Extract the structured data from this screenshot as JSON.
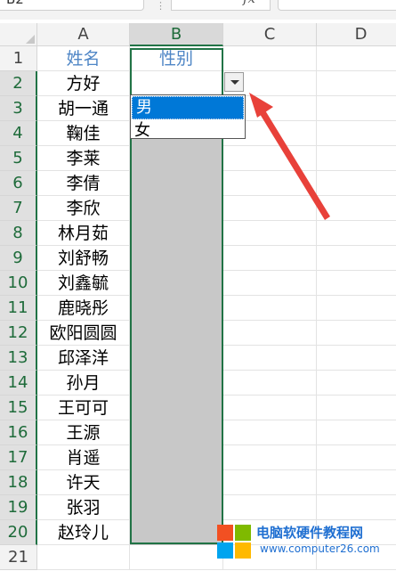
{
  "formula_bar": {
    "name_box": "B2",
    "fx_label": "fx",
    "formula": ""
  },
  "columns": [
    "A",
    "B",
    "C",
    "D"
  ],
  "rows": [
    "1",
    "2",
    "3",
    "4",
    "5",
    "6",
    "7",
    "8",
    "9",
    "10",
    "11",
    "12",
    "13",
    "14",
    "15",
    "16",
    "17",
    "18",
    "19",
    "20",
    "21"
  ],
  "sheet": {
    "headers": {
      "a": "姓名",
      "b": "性别"
    },
    "names": [
      "方好",
      "胡一通",
      "鞠佳",
      "李莱",
      "李倩",
      "李欣",
      "林月茹",
      "刘舒畅",
      "刘鑫毓",
      "鹿晓彤",
      "欧阳圆圆",
      "邱泽洋",
      "孙月",
      "王可可",
      "王源",
      "肖遥",
      "许天",
      "张羽",
      "赵玲儿"
    ]
  },
  "dropdown": {
    "options": [
      "男",
      "女"
    ],
    "highlighted_index": 0
  },
  "colors": {
    "selection_border": "#217346",
    "header_text": "#4f86c6",
    "dropdown_highlight": "#0078d7",
    "arrow": "#e8413a",
    "range_fill": "#c8c8c8"
  },
  "watermark": {
    "title": "电脑软硬件教程网",
    "url": "www.computer26.com"
  }
}
